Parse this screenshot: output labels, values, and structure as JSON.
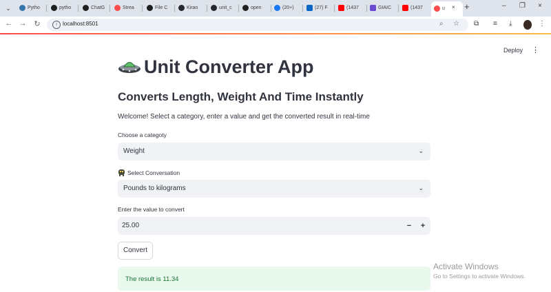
{
  "browser": {
    "tabs": [
      {
        "label": "Pytho",
        "color": "#3776ab"
      },
      {
        "label": "pytho",
        "color": "#1e1e1e"
      },
      {
        "label": "ChatG",
        "color": "#202020"
      },
      {
        "label": "Strea",
        "color": "#ff4b4b"
      },
      {
        "label": "File C",
        "color": "#1e1e1e"
      },
      {
        "label": "Kiran",
        "color": "#24292f"
      },
      {
        "label": "unit_c",
        "color": "#24292f"
      },
      {
        "label": "open",
        "color": "#202020"
      },
      {
        "label": "(20+)",
        "color": "#1877f2"
      },
      {
        "label": "(27) F",
        "color": "#0a66c2"
      },
      {
        "label": "(1437",
        "color": "#ff0000"
      },
      {
        "label": "GIAIC",
        "color": "#6c4ad0"
      },
      {
        "label": "(1437",
        "color": "#ff0000"
      }
    ],
    "active_tab": {
      "label": "u",
      "color": "#ff4b4b"
    },
    "close_glyph": "×",
    "new_tab_glyph": "+",
    "window_controls": {
      "minimize": "–",
      "restore": "❐",
      "close": "×"
    },
    "url": "localhost:8501"
  },
  "app": {
    "deploy_label": "Deploy",
    "title": "Unit Converter App",
    "subtitle": "Converts Length, Weight And Time Instantly",
    "intro": "Welcome! Select a category, enter a value and get the converted result in real-time",
    "category_label": "Choose a categoty",
    "category_value": "Weight",
    "conversion_label": "Select Conversation",
    "conversion_value": "Pounds to kilograms",
    "input_label": "Enter the value to convert",
    "input_value": "25.00",
    "minus": "−",
    "plus": "+",
    "convert_label": "Convert",
    "result_text": "The result is 11.34"
  },
  "watermark": {
    "line1": "Activate Windows",
    "line2": "Go to Settings to activate Windows."
  },
  "colors": {
    "accent": "#ff4b4b",
    "success_bg": "#e9f9ee",
    "success_text": "#177233"
  }
}
